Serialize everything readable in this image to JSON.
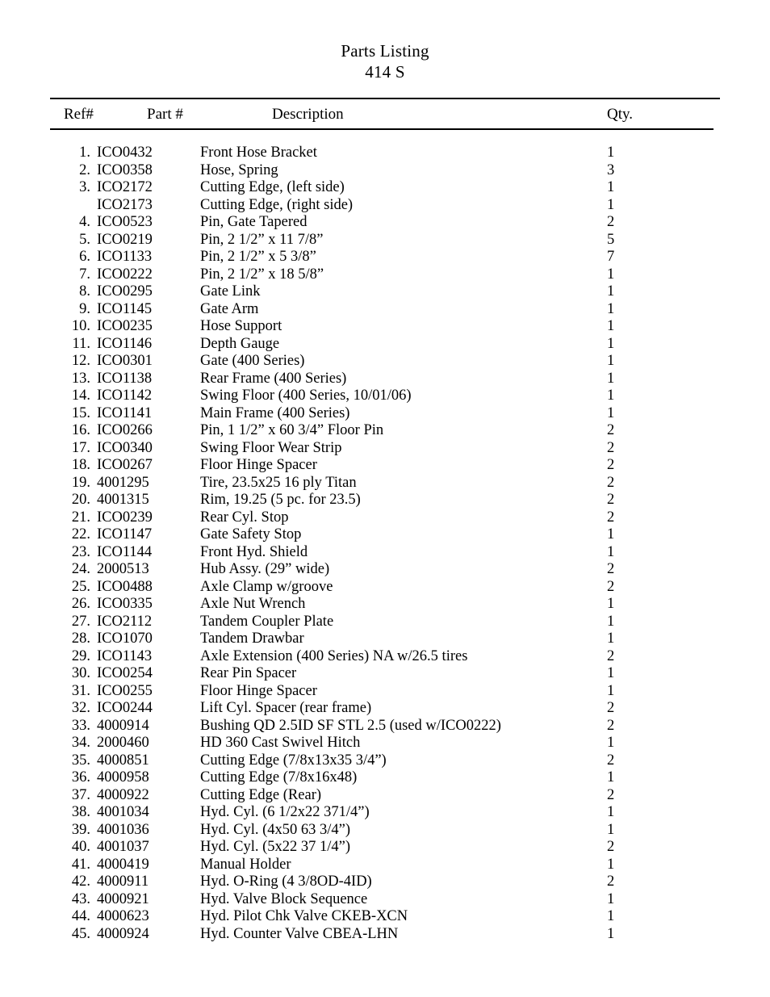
{
  "document": {
    "title": "Parts Listing",
    "subtitle": "414 S"
  },
  "table": {
    "headers": {
      "ref": "Ref#",
      "part": "Part #",
      "description": "Description",
      "qty": "Qty."
    },
    "rows": [
      {
        "ref": "1.",
        "part": "ICO0432",
        "description": "Front Hose Bracket",
        "qty": "1"
      },
      {
        "ref": "2.",
        "part": "ICO0358",
        "description": "Hose, Spring",
        "qty": "3"
      },
      {
        "ref": "3.",
        "part": "ICO2172",
        "description": "Cutting Edge, (left side)",
        "qty": "1"
      },
      {
        "ref": "",
        "part": "ICO2173",
        "description": "Cutting Edge, (right side)",
        "qty": "1"
      },
      {
        "ref": "4.",
        "part": "ICO0523",
        "description": "Pin, Gate Tapered",
        "qty": "2"
      },
      {
        "ref": "5.",
        "part": "ICO0219",
        "description": "Pin, 2 1/2” x 11 7/8”",
        "qty": "5"
      },
      {
        "ref": "6.",
        "part": "ICO1133",
        "description": "Pin, 2 1/2” x 5 3/8”",
        "qty": "7"
      },
      {
        "ref": "7.",
        "part": "ICO0222",
        "description": "Pin, 2 1/2” x 18 5/8”",
        "qty": "1"
      },
      {
        "ref": "8.",
        "part": "ICO0295",
        "description": "Gate Link",
        "qty": "1"
      },
      {
        "ref": "9.",
        "part": "ICO1145",
        "description": "Gate Arm",
        "qty": "1"
      },
      {
        "ref": "10.",
        "part": "ICO0235",
        "description": "Hose Support",
        "qty": "1"
      },
      {
        "ref": "11.",
        "part": "ICO1146",
        "description": "Depth Gauge",
        "qty": "1"
      },
      {
        "ref": "12.",
        "part": "ICO0301",
        "description": "Gate (400 Series)",
        "qty": "1"
      },
      {
        "ref": "13.",
        "part": "ICO1138",
        "description": "Rear Frame (400 Series)",
        "qty": "1"
      },
      {
        "ref": "14.",
        "part": "ICO1142",
        "description": "Swing Floor (400 Series, 10/01/06)",
        "qty": "1"
      },
      {
        "ref": "15.",
        "part": "ICO1141",
        "description": "Main Frame (400 Series)",
        "qty": "1"
      },
      {
        "ref": "16.",
        "part": "ICO0266",
        "description": "Pin, 1 1/2” x 60 3/4” Floor Pin",
        "qty": "2"
      },
      {
        "ref": "17.",
        "part": "ICO0340",
        "description": "Swing Floor Wear Strip",
        "qty": "2"
      },
      {
        "ref": "18.",
        "part": "ICO0267",
        "description": "Floor Hinge Spacer",
        "qty": "2"
      },
      {
        "ref": "19.",
        "part": "4001295",
        "description": "Tire, 23.5x25 16 ply Titan",
        "qty": "2"
      },
      {
        "ref": "20.",
        "part": "4001315",
        "description": "Rim, 19.25 (5 pc. for 23.5)",
        "qty": "2"
      },
      {
        "ref": "21.",
        "part": "ICO0239",
        "description": "Rear Cyl. Stop",
        "qty": "2"
      },
      {
        "ref": "22.",
        "part": "ICO1147",
        "description": "Gate Safety Stop",
        "qty": "1"
      },
      {
        "ref": "23.",
        "part": "ICO1144",
        "description": "Front Hyd. Shield",
        "qty": "1"
      },
      {
        "ref": "24.",
        "part": "2000513",
        "description": "Hub Assy. (29” wide)",
        "qty": "2"
      },
      {
        "ref": "25.",
        "part": "ICO0488",
        "description": "Axle Clamp w/groove",
        "qty": "2"
      },
      {
        "ref": "26.",
        "part": "ICO0335",
        "description": "Axle Nut Wrench",
        "qty": "1"
      },
      {
        "ref": "27.",
        "part": "ICO2112",
        "description": "Tandem Coupler Plate",
        "qty": "1"
      },
      {
        "ref": "28.",
        "part": "ICO1070",
        "description": "Tandem Drawbar",
        "qty": "1"
      },
      {
        "ref": "29.",
        "part": "ICO1143",
        "description": "Axle Extension (400 Series) NA w/26.5 tires",
        "qty": "2"
      },
      {
        "ref": "30.",
        "part": "ICO0254",
        "description": "Rear Pin Spacer",
        "qty": "1"
      },
      {
        "ref": "31.",
        "part": "ICO0255",
        "description": "Floor Hinge Spacer",
        "qty": "1"
      },
      {
        "ref": "32.",
        "part": "ICO0244",
        "description": "Lift Cyl. Spacer (rear frame)",
        "qty": "2"
      },
      {
        "ref": "33.",
        "part": "4000914",
        "description": "Bushing QD 2.5ID SF STL 2.5 (used w/ICO0222)",
        "qty": "2"
      },
      {
        "ref": "34.",
        "part": "2000460",
        "description": "HD 360 Cast Swivel Hitch",
        "qty": "1"
      },
      {
        "ref": "35.",
        "part": "4000851",
        "description": "Cutting Edge (7/8x13x35 3/4”)",
        "qty": "2"
      },
      {
        "ref": "36.",
        "part": "4000958",
        "description": "Cutting Edge (7/8x16x48)",
        "qty": "1"
      },
      {
        "ref": "37.",
        "part": "4000922",
        "description": "Cutting Edge (Rear)",
        "qty": "2"
      },
      {
        "ref": "38.",
        "part": "4001034",
        "description": "Hyd. Cyl. (6 1/2x22  371/4”)",
        "qty": "1"
      },
      {
        "ref": "39.",
        "part": "4001036",
        "description": "Hyd. Cyl. (4x50  63 3/4”)",
        "qty": "1"
      },
      {
        "ref": "40.",
        "part": "4001037",
        "description": "Hyd. Cyl. (5x22  37 1/4”)",
        "qty": "2"
      },
      {
        "ref": "41.",
        "part": "4000419",
        "description": "Manual Holder",
        "qty": "1"
      },
      {
        "ref": "42.",
        "part": "4000911",
        "description": "Hyd. O-Ring (4 3/8OD-4ID)",
        "qty": "2"
      },
      {
        "ref": "43.",
        "part": "4000921",
        "description": "Hyd. Valve Block Sequence",
        "qty": "1"
      },
      {
        "ref": "44.",
        "part": "4000623",
        "description": "Hyd. Pilot Chk Valve CKEB-XCN",
        "qty": "1"
      },
      {
        "ref": "45.",
        "part": "4000924",
        "description": "Hyd. Counter Valve CBEA-LHN",
        "qty": "1"
      }
    ]
  }
}
